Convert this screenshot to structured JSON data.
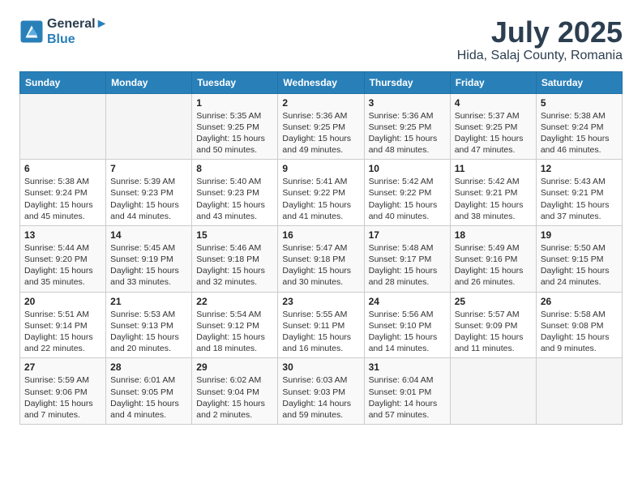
{
  "logo": {
    "line1": "General",
    "line2": "Blue"
  },
  "title": "July 2025",
  "subtitle": "Hida, Salaj County, Romania",
  "days_of_week": [
    "Sunday",
    "Monday",
    "Tuesday",
    "Wednesday",
    "Thursday",
    "Friday",
    "Saturday"
  ],
  "weeks": [
    [
      {
        "day": "",
        "info": ""
      },
      {
        "day": "",
        "info": ""
      },
      {
        "day": "1",
        "info": "Sunrise: 5:35 AM\nSunset: 9:25 PM\nDaylight: 15 hours\nand 50 minutes."
      },
      {
        "day": "2",
        "info": "Sunrise: 5:36 AM\nSunset: 9:25 PM\nDaylight: 15 hours\nand 49 minutes."
      },
      {
        "day": "3",
        "info": "Sunrise: 5:36 AM\nSunset: 9:25 PM\nDaylight: 15 hours\nand 48 minutes."
      },
      {
        "day": "4",
        "info": "Sunrise: 5:37 AM\nSunset: 9:25 PM\nDaylight: 15 hours\nand 47 minutes."
      },
      {
        "day": "5",
        "info": "Sunrise: 5:38 AM\nSunset: 9:24 PM\nDaylight: 15 hours\nand 46 minutes."
      }
    ],
    [
      {
        "day": "6",
        "info": "Sunrise: 5:38 AM\nSunset: 9:24 PM\nDaylight: 15 hours\nand 45 minutes."
      },
      {
        "day": "7",
        "info": "Sunrise: 5:39 AM\nSunset: 9:23 PM\nDaylight: 15 hours\nand 44 minutes."
      },
      {
        "day": "8",
        "info": "Sunrise: 5:40 AM\nSunset: 9:23 PM\nDaylight: 15 hours\nand 43 minutes."
      },
      {
        "day": "9",
        "info": "Sunrise: 5:41 AM\nSunset: 9:22 PM\nDaylight: 15 hours\nand 41 minutes."
      },
      {
        "day": "10",
        "info": "Sunrise: 5:42 AM\nSunset: 9:22 PM\nDaylight: 15 hours\nand 40 minutes."
      },
      {
        "day": "11",
        "info": "Sunrise: 5:42 AM\nSunset: 9:21 PM\nDaylight: 15 hours\nand 38 minutes."
      },
      {
        "day": "12",
        "info": "Sunrise: 5:43 AM\nSunset: 9:21 PM\nDaylight: 15 hours\nand 37 minutes."
      }
    ],
    [
      {
        "day": "13",
        "info": "Sunrise: 5:44 AM\nSunset: 9:20 PM\nDaylight: 15 hours\nand 35 minutes."
      },
      {
        "day": "14",
        "info": "Sunrise: 5:45 AM\nSunset: 9:19 PM\nDaylight: 15 hours\nand 33 minutes."
      },
      {
        "day": "15",
        "info": "Sunrise: 5:46 AM\nSunset: 9:18 PM\nDaylight: 15 hours\nand 32 minutes."
      },
      {
        "day": "16",
        "info": "Sunrise: 5:47 AM\nSunset: 9:18 PM\nDaylight: 15 hours\nand 30 minutes."
      },
      {
        "day": "17",
        "info": "Sunrise: 5:48 AM\nSunset: 9:17 PM\nDaylight: 15 hours\nand 28 minutes."
      },
      {
        "day": "18",
        "info": "Sunrise: 5:49 AM\nSunset: 9:16 PM\nDaylight: 15 hours\nand 26 minutes."
      },
      {
        "day": "19",
        "info": "Sunrise: 5:50 AM\nSunset: 9:15 PM\nDaylight: 15 hours\nand 24 minutes."
      }
    ],
    [
      {
        "day": "20",
        "info": "Sunrise: 5:51 AM\nSunset: 9:14 PM\nDaylight: 15 hours\nand 22 minutes."
      },
      {
        "day": "21",
        "info": "Sunrise: 5:53 AM\nSunset: 9:13 PM\nDaylight: 15 hours\nand 20 minutes."
      },
      {
        "day": "22",
        "info": "Sunrise: 5:54 AM\nSunset: 9:12 PM\nDaylight: 15 hours\nand 18 minutes."
      },
      {
        "day": "23",
        "info": "Sunrise: 5:55 AM\nSunset: 9:11 PM\nDaylight: 15 hours\nand 16 minutes."
      },
      {
        "day": "24",
        "info": "Sunrise: 5:56 AM\nSunset: 9:10 PM\nDaylight: 15 hours\nand 14 minutes."
      },
      {
        "day": "25",
        "info": "Sunrise: 5:57 AM\nSunset: 9:09 PM\nDaylight: 15 hours\nand 11 minutes."
      },
      {
        "day": "26",
        "info": "Sunrise: 5:58 AM\nSunset: 9:08 PM\nDaylight: 15 hours\nand 9 minutes."
      }
    ],
    [
      {
        "day": "27",
        "info": "Sunrise: 5:59 AM\nSunset: 9:06 PM\nDaylight: 15 hours\nand 7 minutes."
      },
      {
        "day": "28",
        "info": "Sunrise: 6:01 AM\nSunset: 9:05 PM\nDaylight: 15 hours\nand 4 minutes."
      },
      {
        "day": "29",
        "info": "Sunrise: 6:02 AM\nSunset: 9:04 PM\nDaylight: 15 hours\nand 2 minutes."
      },
      {
        "day": "30",
        "info": "Sunrise: 6:03 AM\nSunset: 9:03 PM\nDaylight: 14 hours\nand 59 minutes."
      },
      {
        "day": "31",
        "info": "Sunrise: 6:04 AM\nSunset: 9:01 PM\nDaylight: 14 hours\nand 57 minutes."
      },
      {
        "day": "",
        "info": ""
      },
      {
        "day": "",
        "info": ""
      }
    ]
  ]
}
